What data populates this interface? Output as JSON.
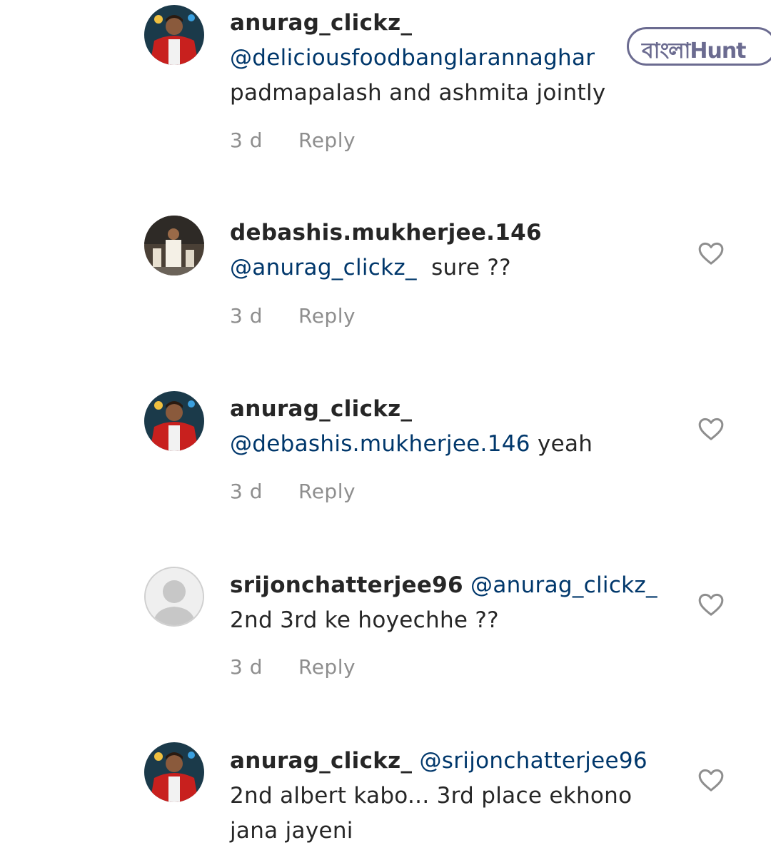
{
  "watermark": {
    "text": "বাংলাHunt"
  },
  "comments": [
    {
      "username": "anurag_clickz_",
      "mention": "@deliciousfoodbanglarannaghar",
      "text": "padmapalash and ashmita jointly",
      "age": "3 d",
      "reply_label": "Reply"
    },
    {
      "username": "debashis.mukherjee.146",
      "mention": "@anurag_clickz_",
      "text": "sure ??",
      "age": "3 d",
      "reply_label": "Reply"
    },
    {
      "username": "anurag_clickz_",
      "mention": "@debashis.mukherjee.146",
      "text": "yeah",
      "age": "3 d",
      "reply_label": "Reply"
    },
    {
      "username": "srijonchatterjee96",
      "mention": "@anurag_clickz_",
      "text": "2nd 3rd ke hoyechhe ??",
      "age": "3 d",
      "reply_label": "Reply"
    },
    {
      "username": "anurag_clickz_",
      "mention": "@srijonchatterjee96",
      "text": "2nd albert kabo... 3rd place ekhono jana jayeni"
    }
  ],
  "colors": {
    "mention": "#00376b",
    "meta": "#8e8e8e",
    "text": "#262626",
    "watermark": "#6b6b90"
  }
}
